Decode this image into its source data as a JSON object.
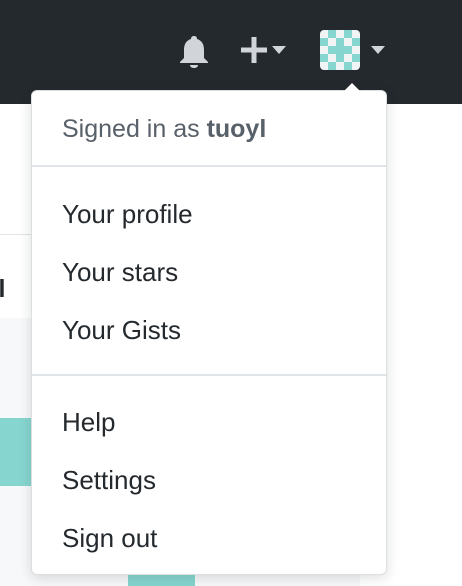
{
  "header": {
    "notifications_icon": "bell-icon",
    "create_icon": "plus-icon",
    "avatar_icon": "identicon-avatar",
    "avatar_colors": {
      "fill": "#86d5cf",
      "bg": "#f0f4f5"
    }
  },
  "background": {
    "profile_tab_partial": "ofil"
  },
  "dropdown": {
    "signed_in_prefix": "Signed in as",
    "username": "tuoyl",
    "section1": [
      "Your profile",
      "Your stars",
      "Your Gists"
    ],
    "section2": [
      "Help",
      "Settings",
      "Sign out"
    ]
  },
  "colors": {
    "header_bg": "#24292e",
    "accent_teal": "#86d5cf",
    "text_primary": "#24292e",
    "text_muted": "#586069"
  }
}
